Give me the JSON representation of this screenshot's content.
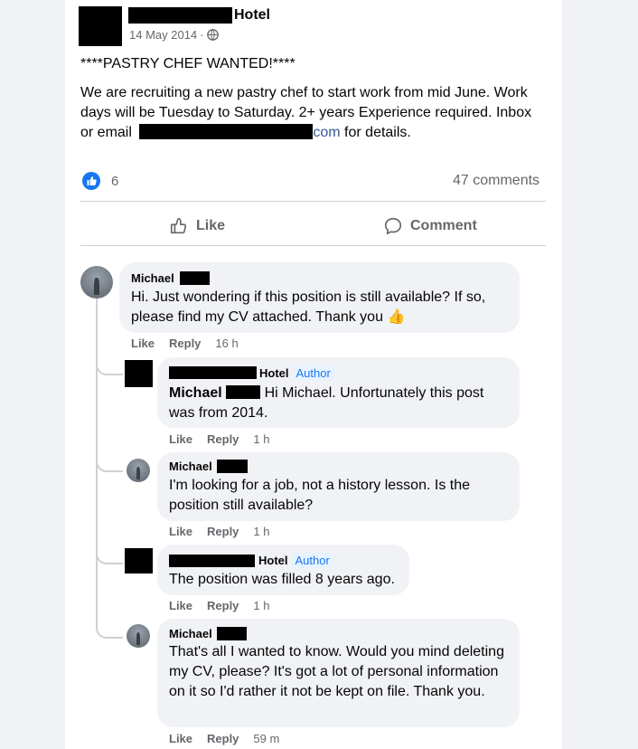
{
  "post": {
    "author_suffix": "Hotel",
    "date": "14 May 2014",
    "dot": "·",
    "privacy_icon": "globe-icon",
    "headline": "****PASTRY CHEF WANTED!****",
    "body_line1": "We are recruiting a new pastry chef to start work from mid June. Work",
    "body_line2": "days will be Tuesday to Saturday. 2+ years Experience required. Inbox",
    "body_line3_prefix": "or email",
    "email_suffix": "com",
    "body_line3_suffix": "for details."
  },
  "stats": {
    "likes_icon": "like-reaction-icon",
    "like_count": "6",
    "comment_count": "47 comments"
  },
  "actions": {
    "like_label": "Like",
    "comment_label": "Comment"
  },
  "comments": [
    {
      "name": "Michael",
      "text": "Hi. Just wondering if this position is still available? If so, please find my CV attached. Thank you",
      "emoji": "👍",
      "like": "Like",
      "reply": "Reply",
      "time": "16 h"
    },
    {
      "name_suffix": "Hotel",
      "badge": "Author",
      "mention": "Michael",
      "text": "Hi Michael. Unfortunately this post was from 2014.",
      "like": "Like",
      "reply": "Reply",
      "time": "1 h"
    },
    {
      "name": "Michael",
      "text": "I'm looking for a job, not a history lesson. Is the position still available?",
      "like": "Like",
      "reply": "Reply",
      "time": "1 h"
    },
    {
      "name_suffix": "Hotel",
      "badge": "Author",
      "text": "The position was filled 8 years ago.",
      "like": "Like",
      "reply": "Reply",
      "time": "1 h"
    },
    {
      "name": "Michael",
      "text": "That's all I wanted to know. Would you mind deleting my CV, please? It's got a lot of personal information on it so I'd rather it not be kept on file. Thank you.",
      "like": "Like",
      "reply": "Reply",
      "time": "59 m"
    }
  ]
}
